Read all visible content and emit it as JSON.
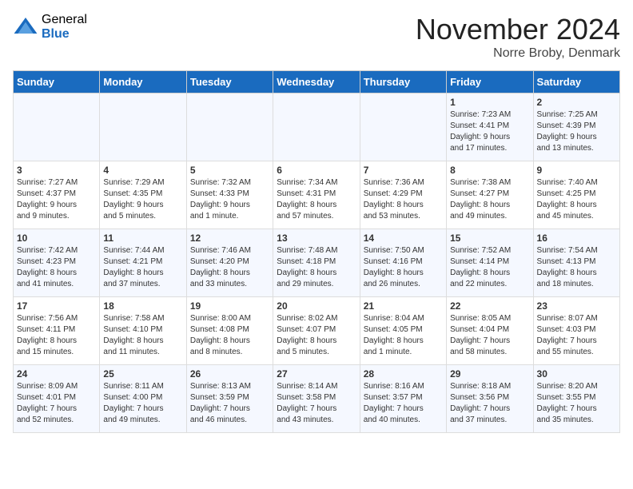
{
  "header": {
    "logo_general": "General",
    "logo_blue": "Blue",
    "title": "November 2024",
    "location": "Norre Broby, Denmark"
  },
  "weekdays": [
    "Sunday",
    "Monday",
    "Tuesday",
    "Wednesday",
    "Thursday",
    "Friday",
    "Saturday"
  ],
  "weeks": [
    [
      {
        "day": "",
        "info": ""
      },
      {
        "day": "",
        "info": ""
      },
      {
        "day": "",
        "info": ""
      },
      {
        "day": "",
        "info": ""
      },
      {
        "day": "",
        "info": ""
      },
      {
        "day": "1",
        "info": "Sunrise: 7:23 AM\nSunset: 4:41 PM\nDaylight: 9 hours\nand 17 minutes."
      },
      {
        "day": "2",
        "info": "Sunrise: 7:25 AM\nSunset: 4:39 PM\nDaylight: 9 hours\nand 13 minutes."
      }
    ],
    [
      {
        "day": "3",
        "info": "Sunrise: 7:27 AM\nSunset: 4:37 PM\nDaylight: 9 hours\nand 9 minutes."
      },
      {
        "day": "4",
        "info": "Sunrise: 7:29 AM\nSunset: 4:35 PM\nDaylight: 9 hours\nand 5 minutes."
      },
      {
        "day": "5",
        "info": "Sunrise: 7:32 AM\nSunset: 4:33 PM\nDaylight: 9 hours\nand 1 minute."
      },
      {
        "day": "6",
        "info": "Sunrise: 7:34 AM\nSunset: 4:31 PM\nDaylight: 8 hours\nand 57 minutes."
      },
      {
        "day": "7",
        "info": "Sunrise: 7:36 AM\nSunset: 4:29 PM\nDaylight: 8 hours\nand 53 minutes."
      },
      {
        "day": "8",
        "info": "Sunrise: 7:38 AM\nSunset: 4:27 PM\nDaylight: 8 hours\nand 49 minutes."
      },
      {
        "day": "9",
        "info": "Sunrise: 7:40 AM\nSunset: 4:25 PM\nDaylight: 8 hours\nand 45 minutes."
      }
    ],
    [
      {
        "day": "10",
        "info": "Sunrise: 7:42 AM\nSunset: 4:23 PM\nDaylight: 8 hours\nand 41 minutes."
      },
      {
        "day": "11",
        "info": "Sunrise: 7:44 AM\nSunset: 4:21 PM\nDaylight: 8 hours\nand 37 minutes."
      },
      {
        "day": "12",
        "info": "Sunrise: 7:46 AM\nSunset: 4:20 PM\nDaylight: 8 hours\nand 33 minutes."
      },
      {
        "day": "13",
        "info": "Sunrise: 7:48 AM\nSunset: 4:18 PM\nDaylight: 8 hours\nand 29 minutes."
      },
      {
        "day": "14",
        "info": "Sunrise: 7:50 AM\nSunset: 4:16 PM\nDaylight: 8 hours\nand 26 minutes."
      },
      {
        "day": "15",
        "info": "Sunrise: 7:52 AM\nSunset: 4:14 PM\nDaylight: 8 hours\nand 22 minutes."
      },
      {
        "day": "16",
        "info": "Sunrise: 7:54 AM\nSunset: 4:13 PM\nDaylight: 8 hours\nand 18 minutes."
      }
    ],
    [
      {
        "day": "17",
        "info": "Sunrise: 7:56 AM\nSunset: 4:11 PM\nDaylight: 8 hours\nand 15 minutes."
      },
      {
        "day": "18",
        "info": "Sunrise: 7:58 AM\nSunset: 4:10 PM\nDaylight: 8 hours\nand 11 minutes."
      },
      {
        "day": "19",
        "info": "Sunrise: 8:00 AM\nSunset: 4:08 PM\nDaylight: 8 hours\nand 8 minutes."
      },
      {
        "day": "20",
        "info": "Sunrise: 8:02 AM\nSunset: 4:07 PM\nDaylight: 8 hours\nand 5 minutes."
      },
      {
        "day": "21",
        "info": "Sunrise: 8:04 AM\nSunset: 4:05 PM\nDaylight: 8 hours\nand 1 minute."
      },
      {
        "day": "22",
        "info": "Sunrise: 8:05 AM\nSunset: 4:04 PM\nDaylight: 7 hours\nand 58 minutes."
      },
      {
        "day": "23",
        "info": "Sunrise: 8:07 AM\nSunset: 4:03 PM\nDaylight: 7 hours\nand 55 minutes."
      }
    ],
    [
      {
        "day": "24",
        "info": "Sunrise: 8:09 AM\nSunset: 4:01 PM\nDaylight: 7 hours\nand 52 minutes."
      },
      {
        "day": "25",
        "info": "Sunrise: 8:11 AM\nSunset: 4:00 PM\nDaylight: 7 hours\nand 49 minutes."
      },
      {
        "day": "26",
        "info": "Sunrise: 8:13 AM\nSunset: 3:59 PM\nDaylight: 7 hours\nand 46 minutes."
      },
      {
        "day": "27",
        "info": "Sunrise: 8:14 AM\nSunset: 3:58 PM\nDaylight: 7 hours\nand 43 minutes."
      },
      {
        "day": "28",
        "info": "Sunrise: 8:16 AM\nSunset: 3:57 PM\nDaylight: 7 hours\nand 40 minutes."
      },
      {
        "day": "29",
        "info": "Sunrise: 8:18 AM\nSunset: 3:56 PM\nDaylight: 7 hours\nand 37 minutes."
      },
      {
        "day": "30",
        "info": "Sunrise: 8:20 AM\nSunset: 3:55 PM\nDaylight: 7 hours\nand 35 minutes."
      }
    ]
  ]
}
